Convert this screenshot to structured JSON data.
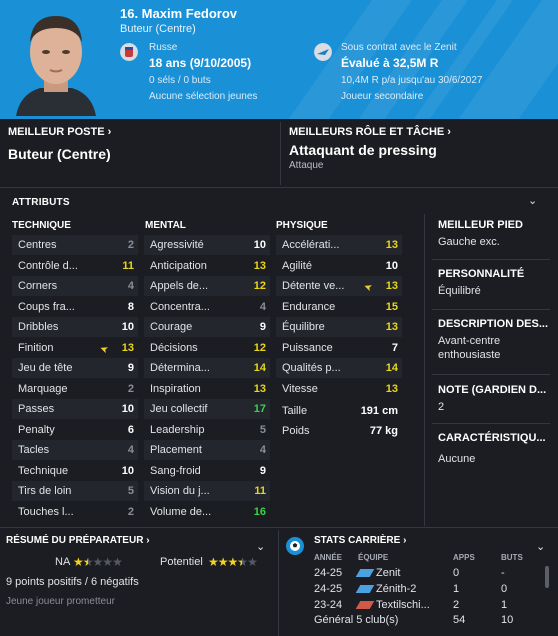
{
  "header": {
    "name": "16. Maxim Fedorov",
    "position": "Buteur (Centre)",
    "nationality": "Russe",
    "age": "18 ans (9/10/2005)",
    "caps": "0 séls / 0 buts",
    "youth_caps": "Aucune sélection jeunes",
    "contract": "Sous contrat avec le Zenit",
    "value": "Évalué à 32,5M R",
    "wage": "10,4M R p/a jusqu'au 30/6/2027",
    "squad_status": "Joueur secondaire"
  },
  "top": {
    "best_pos_title": "MEILLEUR POSTE",
    "best_pos_value": "Buteur (Centre)",
    "best_role_title": "MEILLEURS RÔLE ET TÂCHE",
    "best_role_value": "Attaquant de pressing",
    "best_role_duty": "Attaque"
  },
  "attributes": {
    "title": "ATTRIBUTS",
    "technical_title": "TECHNIQUE",
    "mental_title": "MENTAL",
    "physical_title": "PHYSIQUE",
    "technical": [
      {
        "label": "Centres",
        "value": "2",
        "tone": "grey"
      },
      {
        "label": "Contrôle d...",
        "value": "11",
        "tone": "yellow"
      },
      {
        "label": "Corners",
        "value": "4",
        "tone": "grey"
      },
      {
        "label": "Coups fra...",
        "value": "8",
        "tone": "white"
      },
      {
        "label": "Dribbles",
        "value": "10",
        "tone": "white"
      },
      {
        "label": "Finition",
        "value": "13",
        "tone": "yellow",
        "flag": true
      },
      {
        "label": "Jeu de tête",
        "value": "9",
        "tone": "white"
      },
      {
        "label": "Marquage",
        "value": "2",
        "tone": "grey"
      },
      {
        "label": "Passes",
        "value": "10",
        "tone": "white"
      },
      {
        "label": "Penalty",
        "value": "6",
        "tone": "white"
      },
      {
        "label": "Tacles",
        "value": "4",
        "tone": "grey"
      },
      {
        "label": "Technique",
        "value": "10",
        "tone": "white"
      },
      {
        "label": "Tirs de loin",
        "value": "5",
        "tone": "grey"
      },
      {
        "label": "Touches l...",
        "value": "2",
        "tone": "grey"
      }
    ],
    "mental": [
      {
        "label": "Agressivité",
        "value": "10",
        "tone": "white"
      },
      {
        "label": "Anticipation",
        "value": "13",
        "tone": "yellow"
      },
      {
        "label": "Appels de...",
        "value": "12",
        "tone": "yellow"
      },
      {
        "label": "Concentra...",
        "value": "4",
        "tone": "grey"
      },
      {
        "label": "Courage",
        "value": "9",
        "tone": "white"
      },
      {
        "label": "Décisions",
        "value": "12",
        "tone": "yellow"
      },
      {
        "label": "Détermina...",
        "value": "14",
        "tone": "yellow"
      },
      {
        "label": "Inspiration",
        "value": "13",
        "tone": "yellow"
      },
      {
        "label": "Jeu collectif",
        "value": "17",
        "tone": "green"
      },
      {
        "label": "Leadership",
        "value": "5",
        "tone": "grey"
      },
      {
        "label": "Placement",
        "value": "4",
        "tone": "grey"
      },
      {
        "label": "Sang-froid",
        "value": "9",
        "tone": "white"
      },
      {
        "label": "Vision du j...",
        "value": "11",
        "tone": "yellow"
      },
      {
        "label": "Volume de...",
        "value": "16",
        "tone": "green"
      }
    ],
    "physical": [
      {
        "label": "Accélérati...",
        "value": "13",
        "tone": "yellow"
      },
      {
        "label": "Agilité",
        "value": "10",
        "tone": "white"
      },
      {
        "label": "Détente ve...",
        "value": "13",
        "tone": "yellow",
        "flag": true
      },
      {
        "label": "Endurance",
        "value": "15",
        "tone": "yellow"
      },
      {
        "label": "Équilibre",
        "value": "13",
        "tone": "yellow"
      },
      {
        "label": "Puissance",
        "value": "7",
        "tone": "white"
      },
      {
        "label": "Qualités p...",
        "value": "14",
        "tone": "yellow"
      },
      {
        "label": "Vitesse",
        "value": "13",
        "tone": "yellow"
      }
    ],
    "height_label": "Taille",
    "height_value": "191 cm",
    "weight_label": "Poids",
    "weight_value": "77 kg"
  },
  "side": {
    "foot_title": "MEILLEUR PIED",
    "foot_value": "Gauche exc.",
    "personality_title": "PERSONNALITÉ",
    "personality_value": "Équilibré",
    "description_title": "DESCRIPTION DES...",
    "description_value": "Avant-centre enthousiaste",
    "gk_title": "NOTE (GARDIEN D...",
    "gk_value": "2",
    "traits_title": "CARACTÉRISTIQU...",
    "traits_value": "Aucune"
  },
  "coach": {
    "title": "RÉSUMÉ DU PRÉPARATEUR",
    "na_label": "NA",
    "na_stars": 1.5,
    "potential_label": "Potentiel",
    "potential_stars": 3.5,
    "summary": "9 points positifs / 6 négatifs",
    "note": "Jeune joueur prometteur"
  },
  "career": {
    "title": "STATS CARRIÈRE",
    "col_year": "ANNÉE",
    "col_team": "ÉQUIPE",
    "col_apps": "APPS",
    "col_goals": "BUTS",
    "rows": [
      {
        "year": "24-25",
        "team": "Zenit",
        "apps": "0",
        "goals": "-"
      },
      {
        "year": "24-25",
        "team": "Zénith-2",
        "apps": "1",
        "goals": "0"
      },
      {
        "year": "23-24",
        "team": "Textilschi...",
        "apps": "2",
        "goals": "1"
      }
    ],
    "total_label": "Général 5 club(s)",
    "total_apps": "54",
    "total_goals": "10"
  },
  "colors": {
    "header_bg": "#1a90d6",
    "page_bg": "#1b1d22",
    "yellow": "#e8d61a",
    "green": "#3bd24a"
  }
}
